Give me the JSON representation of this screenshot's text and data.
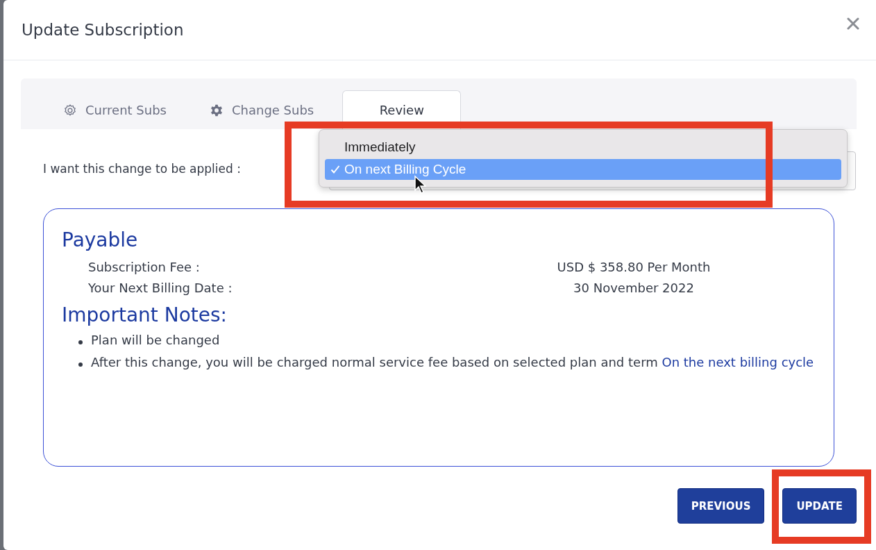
{
  "dialog": {
    "title": "Update Subscription"
  },
  "tabs": [
    {
      "label": "Current Subs",
      "kind": "gear-outline",
      "selected": false
    },
    {
      "label": "Change Subs",
      "kind": "gear-solid",
      "selected": false
    },
    {
      "label": "Review",
      "kind": "plain",
      "selected": true
    }
  ],
  "apply_field": {
    "label": "I want this change to be applied :",
    "options": [
      {
        "label": "Immediately",
        "selected": false
      },
      {
        "label": "On next Billing Cycle",
        "selected": true
      }
    ]
  },
  "payable": {
    "heading": "Payable",
    "rows": [
      {
        "label": "Subscription Fee :",
        "value": "USD $ 358.80 Per Month"
      },
      {
        "label": "Your Next Billing Date :",
        "value": "30 November 2022"
      }
    ]
  },
  "notes": {
    "heading": "Important Notes:",
    "items": [
      {
        "text": "Plan will be changed"
      },
      {
        "text": "After this change, you will be charged normal service fee based on selected plan and term",
        "link": "On the next billing cycle"
      }
    ]
  },
  "buttons": [
    {
      "label": "PREVIOUS"
    },
    {
      "label": "UPDATE"
    }
  ]
}
